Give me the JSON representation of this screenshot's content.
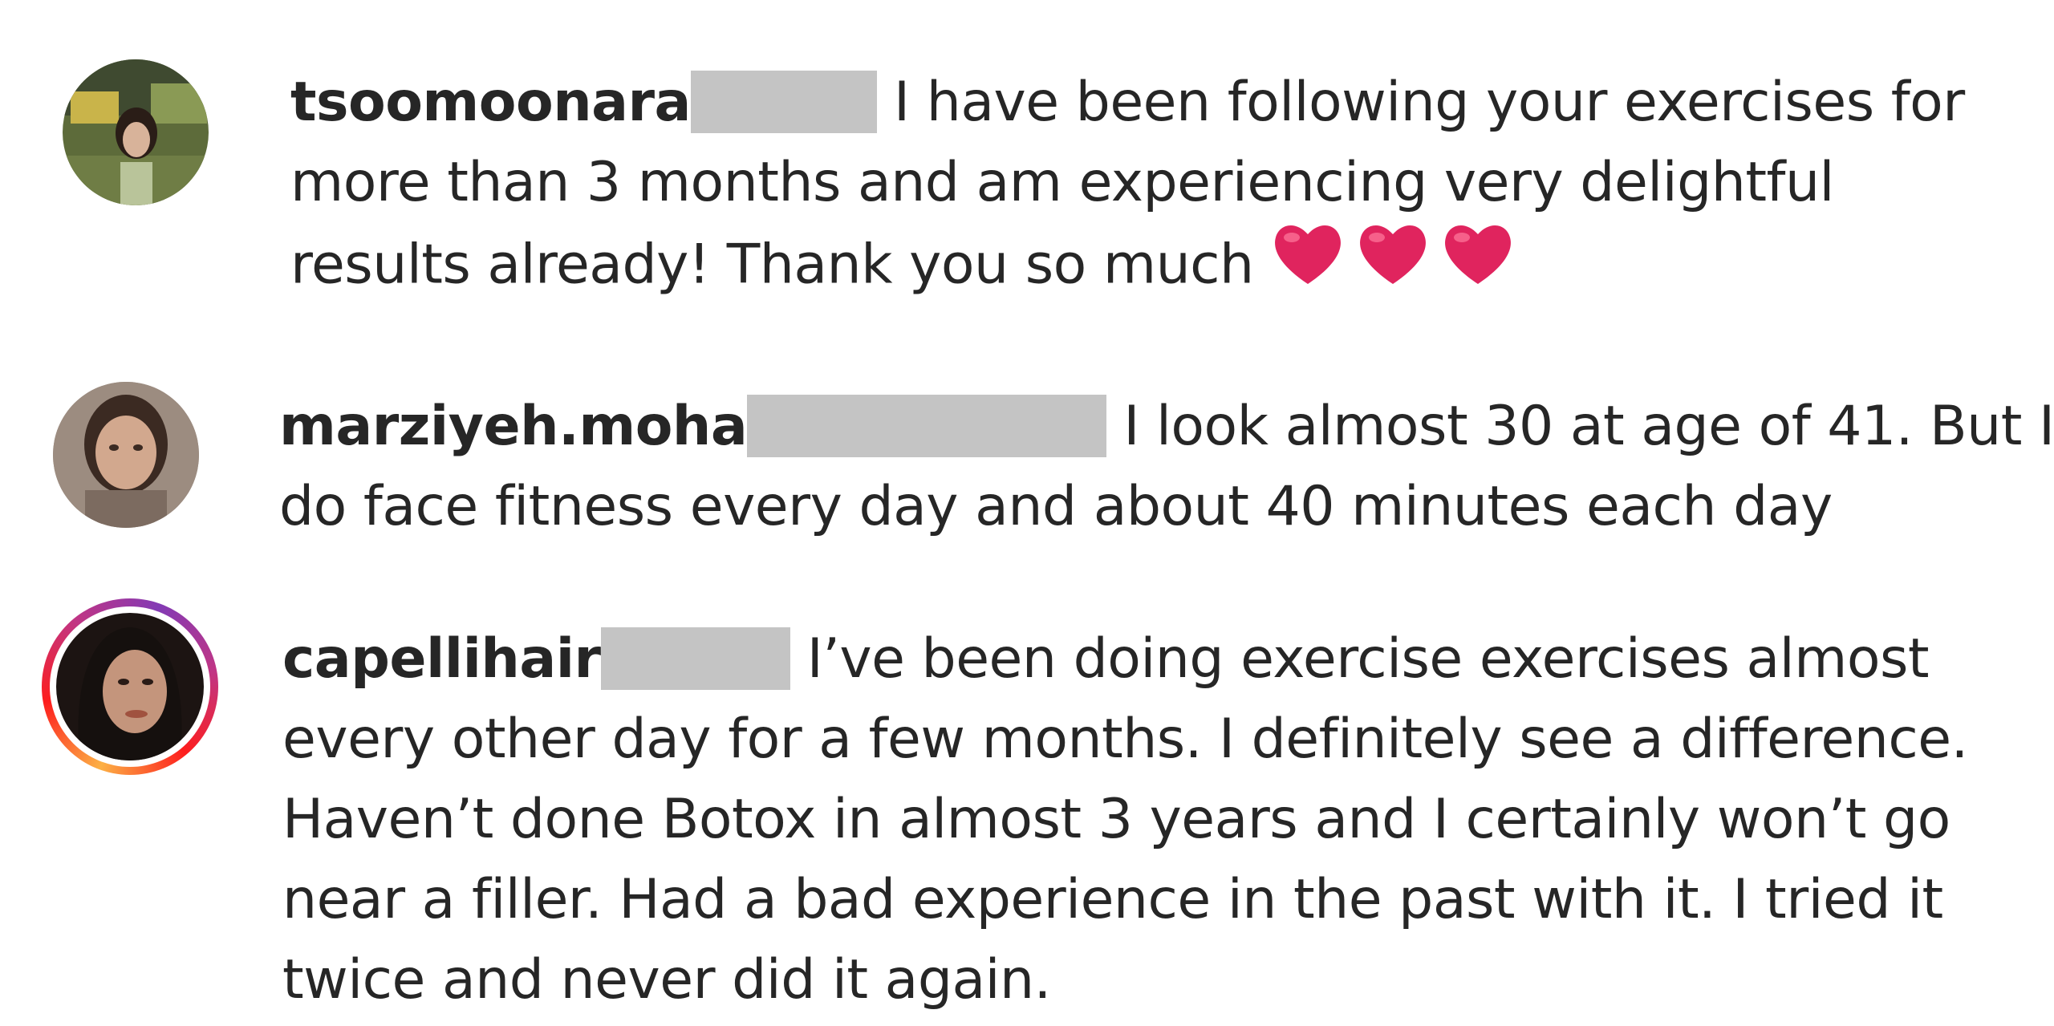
{
  "comments": [
    {
      "username": "tsoomoonara",
      "lines": [
        "I have been following your exercises for",
        "more than 3 months and am experiencing very delightful",
        "results already! Thank you so much"
      ],
      "emoji": [
        "heart",
        "heart",
        "heart"
      ],
      "avatar_story_ring": false
    },
    {
      "username": "marziyeh.moha",
      "lines": [
        "I look almost 30 at age of 41. But I",
        "do face fitness every day and about 40 minutes each day"
      ],
      "avatar_story_ring": false
    },
    {
      "username": "capellihair",
      "lines": [
        "I’ve been doing exercise exercises almost",
        "every other day for a few months. I definitely see a difference.",
        "Haven’t done Botox in almost 3 years and I certainly won’t go",
        "near a filler. Had a bad experience in the past with it. I tried it",
        "twice and never did it again."
      ],
      "avatar_story_ring": true
    }
  ],
  "colors": {
    "text": "#262626",
    "redaction": "#c4c4c4",
    "heart": "#e0245e",
    "story_ring": "#c13584"
  }
}
